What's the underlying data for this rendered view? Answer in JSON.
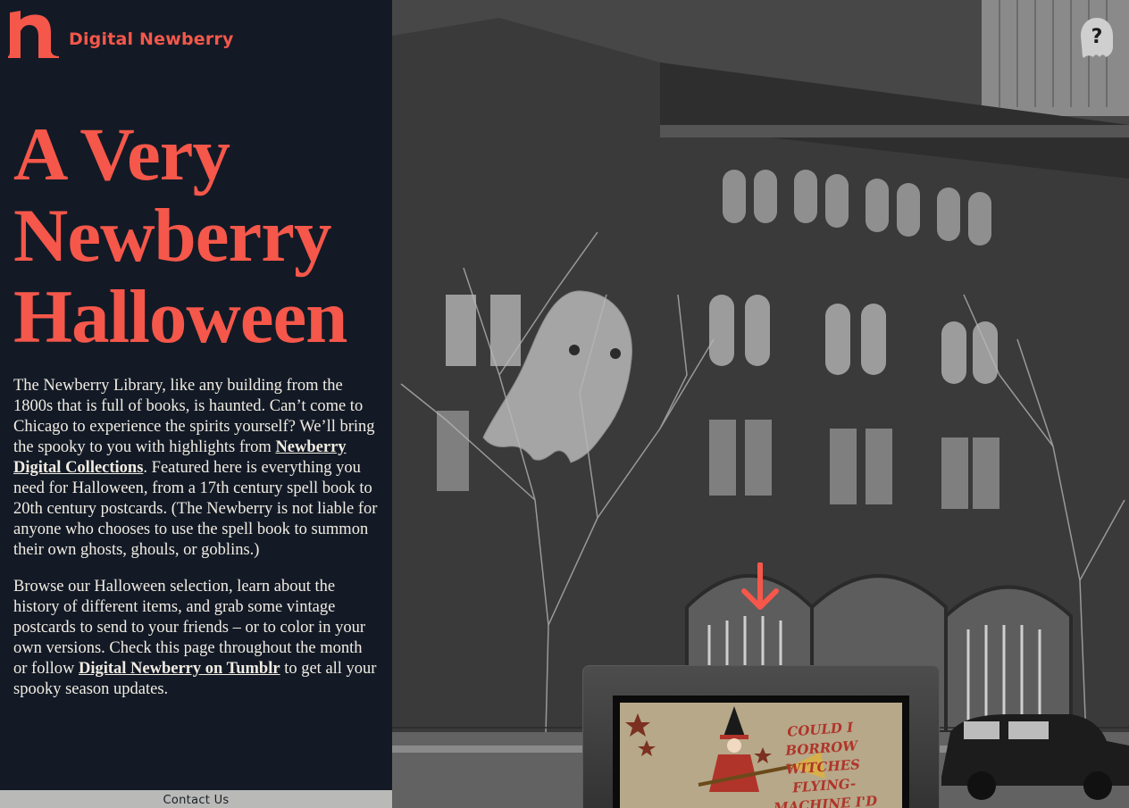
{
  "brand": {
    "name": "Digital Newberry"
  },
  "hero": {
    "title_lines": [
      "A Very",
      "Newberry",
      "Halloween"
    ]
  },
  "intro": {
    "p1_part1": "The Newberry Library, like any building from the 1800s that is full of books, is haunted. Can’t come to Chicago to experience the spirits yourself? We’ll bring the spooky to you with highlights from ",
    "p1_link": "Newberry Digital Collections",
    "p1_part2": ". Featured here is everything you need for Halloween, from a 17th century spell book to 20th century postcards. (The Newberry is not liable for anyone who chooses to use the spell book to summon their own ghosts, ghouls, or goblins.)",
    "p2_part1": "Browse our Halloween selection, learn about the history of different items, and grab some vintage postcards to send to your friends – or to color in your own versions. Check this page throughout the month or follow ",
    "p2_link": "Digital Newberry on Tumblr",
    "p2_part2": " to get all your spooky season updates."
  },
  "footer": {
    "contact_label": "Contact Us"
  },
  "help": {
    "glyph": "?"
  },
  "postcard": {
    "text": "COULD I BORROW WITCHES FLYING-MACHINE I'D VISIT Y"
  },
  "colors": {
    "accent": "#f5574a",
    "sidebar_bg": "#131a26",
    "footer_bg": "#b9b9b7"
  },
  "icons": {
    "help": "ghost-question-icon",
    "scroll": "arrow-down-icon",
    "decor": "ghost-icon",
    "brand": "newberry-n-logo"
  }
}
